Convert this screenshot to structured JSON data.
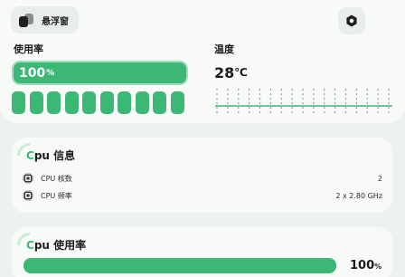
{
  "header": {
    "floating_window_label": "悬浮窗",
    "icons": {
      "floating": "layers-icon",
      "settings": "hexagon-settings-icon"
    }
  },
  "usage": {
    "title": "使用率",
    "value": "100",
    "unit": "%",
    "cores": [
      1,
      1,
      1,
      1,
      1,
      1,
      1,
      1,
      1,
      1
    ]
  },
  "temperature": {
    "title": "温度",
    "value": "28",
    "unit": "℃"
  },
  "cpu_info": {
    "title_accent": "C",
    "title_rest": "pu 信息",
    "rows": [
      {
        "icon": "cpu-chip-icon",
        "label": "CPU 核数",
        "value": "2"
      },
      {
        "icon": "cpu-chip-icon",
        "label": "CPU 频率",
        "value": "2 x 2.80 GHz"
      }
    ]
  },
  "cpu_usage": {
    "title_accent": "C",
    "title_rest": "pu 使用率",
    "value": "100",
    "unit": "%"
  },
  "colors": {
    "accent": "#3db775",
    "accent_light": "#9fe0bd",
    "card": "#f8faf8",
    "background": "#eef2ef"
  }
}
